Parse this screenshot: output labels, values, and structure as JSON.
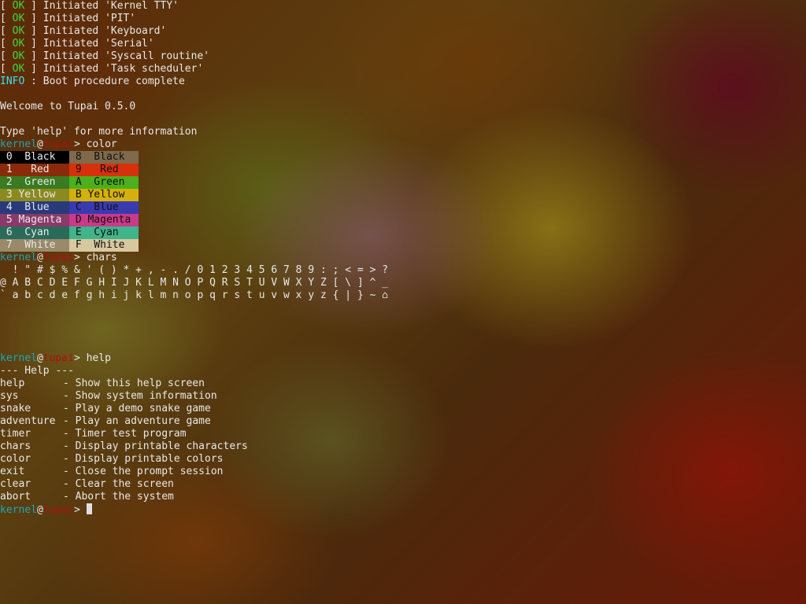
{
  "boot_log": [
    {
      "status": "OK",
      "message": "Initiated 'Kernel TTY'"
    },
    {
      "status": "OK",
      "message": "Initiated 'PIT'"
    },
    {
      "status": "OK",
      "message": "Initiated 'Keyboard'"
    },
    {
      "status": "OK",
      "message": "Initiated 'Serial'"
    },
    {
      "status": "OK",
      "message": "Initiated 'Syscall routine'"
    },
    {
      "status": "OK",
      "message": "Initiated 'Task scheduler'"
    }
  ],
  "info": {
    "tag": "INFO",
    "message": " : Boot procedure complete"
  },
  "welcome": "Welcome to Tupai 0.5.0",
  "hint": "Type 'help' for more information",
  "prompt": {
    "user": "kernel",
    "at": "@",
    "host": "tupai",
    "symbol": ">"
  },
  "commands": {
    "color": " color",
    "chars": " chars",
    "help": " help"
  },
  "color_table": [
    {
      "left": " 0  Black ",
      "left_bg": "#000000",
      "left_fg": "#e8e8e8",
      "right": " 8  Black ",
      "right_bg": "#7f6a4c",
      "right_fg": "#101010"
    },
    {
      "left": " 1   Red  ",
      "left_bg": "#8a2a08",
      "left_fg": "#e8e8e8",
      "right": " 9   Red  ",
      "right_bg": "#d8300c",
      "right_fg": "#101010"
    },
    {
      "left": " 2  Green ",
      "left_bg": "#3a7a20",
      "left_fg": "#e8e8e8",
      "right": " A  Green ",
      "right_bg": "#4caf1c",
      "right_fg": "#101010"
    },
    {
      "left": " 3 Yellow ",
      "left_bg": "#8a8a20",
      "left_fg": "#e8e8e8",
      "right": " B Yellow ",
      "right_bg": "#d4b00c",
      "right_fg": "#101010"
    },
    {
      "left": " 4  Blue  ",
      "left_bg": "#283a7a",
      "left_fg": "#e8e8e8",
      "right": " C  Blue  ",
      "right_bg": "#3a3ab0",
      "right_fg": "#101010"
    },
    {
      "left": " 5 Magenta",
      "left_bg": "#8a3a6a",
      "left_fg": "#e8e8e8",
      "right": " D Magenta",
      "right_bg": "#c83a8a",
      "right_fg": "#101010"
    },
    {
      "left": " 6  Cyan  ",
      "left_bg": "#2a6a5a",
      "left_fg": "#e8e8e8",
      "right": " E  Cyan  ",
      "right_bg": "#40b48a",
      "right_fg": "#101010"
    },
    {
      "left": " 7  White ",
      "left_bg": "#9a8a6a",
      "left_fg": "#e8e8e8",
      "right": " F  White ",
      "right_bg": "#d8c8a0",
      "right_fg": "#101010"
    }
  ],
  "chars_rows": [
    "  ! \" # $ % & ' ( ) * + , - . / 0 1 2 3 4 5 6 7 8 9 : ; < = > ?",
    "@ A B C D E F G H I J K L M N O P Q R S T U V W X Y Z [ \\ ] ^ _",
    "` a b c d e f g h i j k l m n o p q r s t u v w x y z { | } ~ ⌂"
  ],
  "help_title": "--- Help ---",
  "help_entries": [
    {
      "cmd": "help",
      "desc": "- Show this help screen"
    },
    {
      "cmd": "sys",
      "desc": "- Show system information"
    },
    {
      "cmd": "snake",
      "desc": "- Play a demo snake game"
    },
    {
      "cmd": "adventure",
      "desc": "- Play an adventure game"
    },
    {
      "cmd": "timer",
      "desc": "- Timer test program"
    },
    {
      "cmd": "chars",
      "desc": "- Display printable characters"
    },
    {
      "cmd": "color",
      "desc": "- Display printable colors"
    },
    {
      "cmd": "exit",
      "desc": "- Close the prompt session"
    },
    {
      "cmd": "clear",
      "desc": "- Clear the screen"
    },
    {
      "cmd": "abort",
      "desc": "- Abort the system"
    }
  ]
}
